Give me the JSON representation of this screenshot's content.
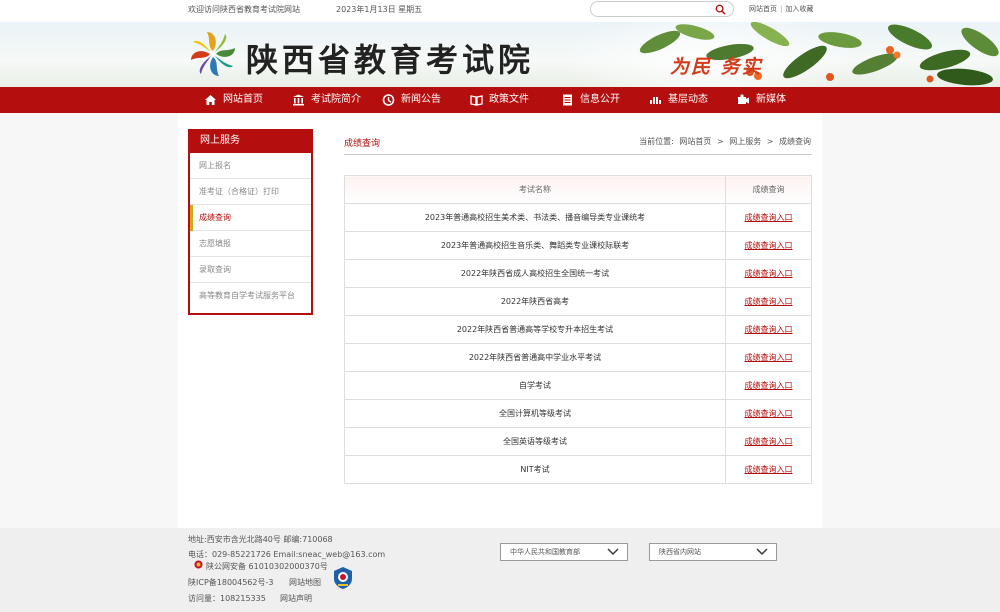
{
  "topbar": {
    "welcome": "欢迎访问陕西省教育考试院网站",
    "date": "2023年1月13日  星期五",
    "search_placeholder": "",
    "link_home": "网站首页",
    "link_separator": "|",
    "link_favorite": "加入收藏"
  },
  "banner": {
    "site_name": "陕西省教育考试院",
    "slogan": "为民  务实"
  },
  "nav": {
    "items": [
      {
        "label": "网站首页",
        "icon": "home-icon"
      },
      {
        "label": "考试院简介",
        "icon": "building-icon"
      },
      {
        "label": "新闻公告",
        "icon": "news-icon"
      },
      {
        "label": "政策文件",
        "icon": "book-icon"
      },
      {
        "label": "信息公开",
        "icon": "document-icon"
      },
      {
        "label": "基层动态",
        "icon": "signal-icon"
      },
      {
        "label": "新媒体",
        "icon": "media-icon"
      }
    ]
  },
  "sidebar": {
    "title": "网上服务",
    "items": [
      {
        "label": "网上报名"
      },
      {
        "label": "准考证（合格证）打印"
      },
      {
        "label": "成绩查询"
      },
      {
        "label": "志愿填报"
      },
      {
        "label": "录取查询"
      },
      {
        "label": "高等教育自学考试服务平台"
      }
    ],
    "active_index": 2
  },
  "main": {
    "section_title": "成绩查询",
    "breadcrumb": {
      "prefix": "当前位置:",
      "home": "网站首页",
      "sep1": ">",
      "level2": "网上服务",
      "sep2": ">",
      "current": "成绩查询"
    },
    "table": {
      "headers": [
        "考试名称",
        "成绩查询"
      ],
      "link_label": "成绩查询入口",
      "rows": [
        "2023年普通高校招生美术类、书法类、播音编导类专业课统考",
        "2023年普通高校招生音乐类、舞蹈类专业课校际联考",
        "2022年陕西省成人高校招生全国统一考试",
        "2022年陕西省高考",
        "2022年陕西省普通高等学校专升本招生考试",
        "2022年陕西省普通高中学业水平考试",
        "自学考试",
        "全国计算机等级考试",
        "全国英语等级考试",
        "NIT考试"
      ]
    }
  },
  "footer": {
    "address": "地址:西安市含光北路40号   邮编:710068",
    "contact": "电话：029-85221726    Email:sneac_web@163.com",
    "police": "陕公网安备 61010302000370号",
    "icp": "陕ICP备18004562号-3",
    "sitemap": "网站地图",
    "visits": "访问量：108215335",
    "statement": "网站声明",
    "select_ministry": "中华人民共和国教育部",
    "select_province": "陕西省内网站"
  },
  "colors": {
    "brand_red": "#b50e0e",
    "active_marker": "#d6a61c",
    "slogan_red": "#d43b1a"
  }
}
